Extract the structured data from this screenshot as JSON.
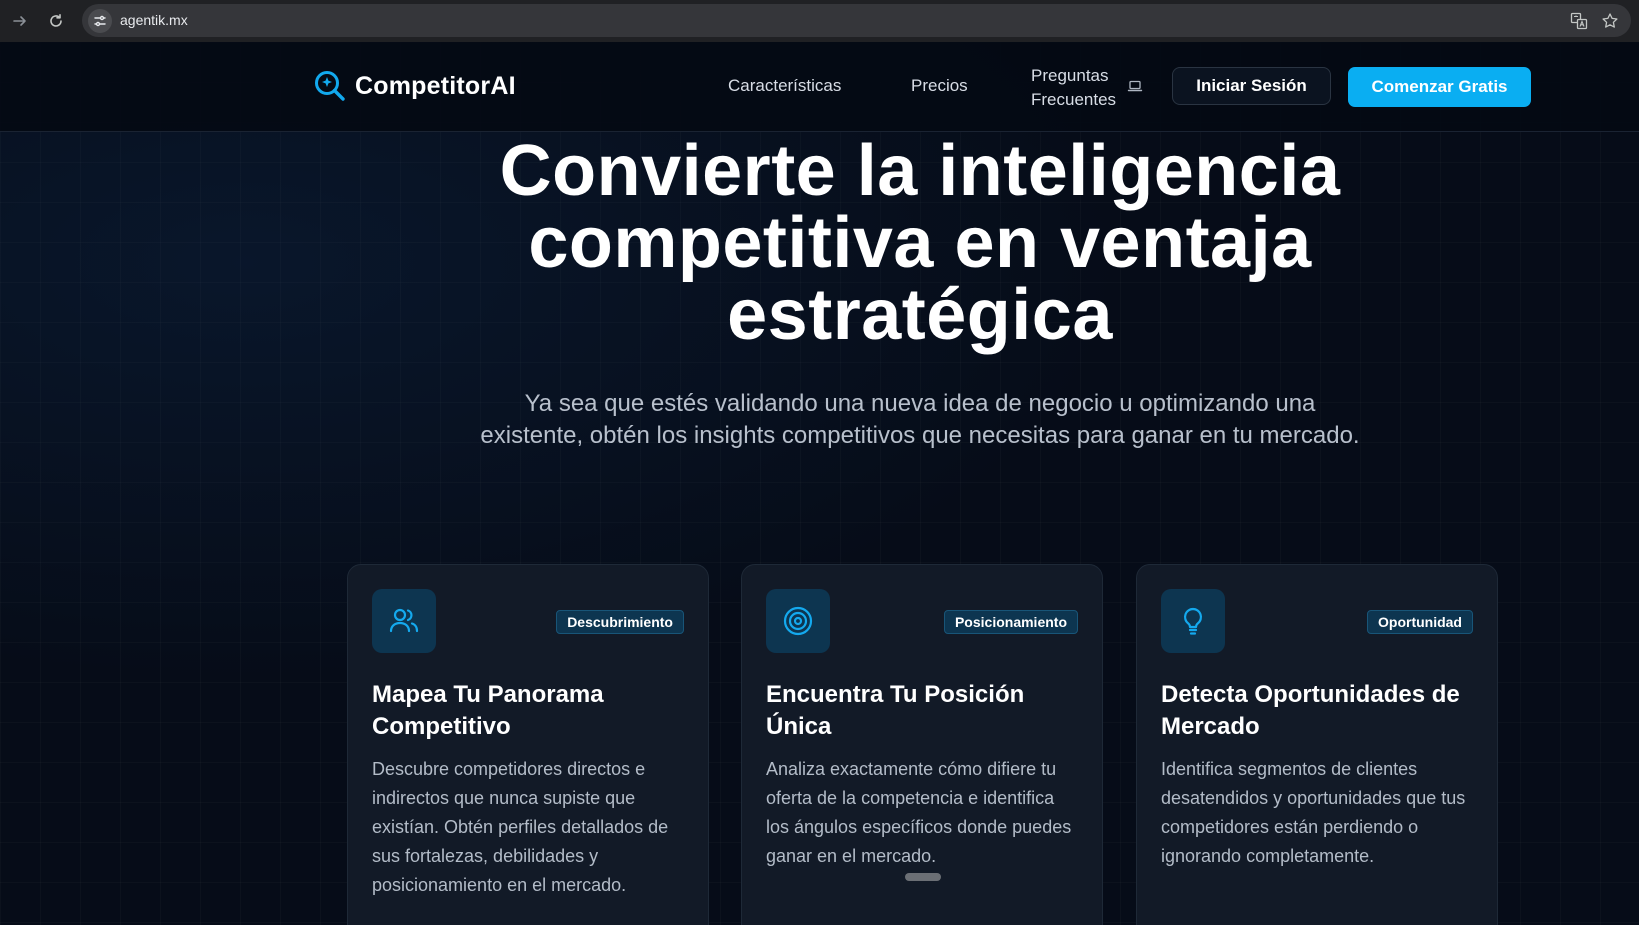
{
  "browser": {
    "url": "agentik.mx",
    "icons": [
      "forward-icon",
      "reload-icon",
      "site-settings-icon",
      "translate-icon",
      "bookmark-star-icon"
    ]
  },
  "header": {
    "logo_text": "CompetitorAI",
    "nav": {
      "features": "Características",
      "pricing": "Precios",
      "faq_line1": "Preguntas",
      "faq_line2": "Frecuentes"
    },
    "login_label": "Iniciar Sesión",
    "start_label": "Comenzar Gratis"
  },
  "hero": {
    "title_line1": "Convierte la inteligencia",
    "title_line2": "competitiva en ventaja",
    "title_line3": "estratégica",
    "subtitle": "Ya sea que estés validando una nueva idea de negocio u optimizando una existente, obtén los insights competitivos que necesitas para ganar en tu mercado."
  },
  "cards": [
    {
      "icon": "users-icon",
      "badge": "Descubrimiento",
      "title": "Mapea Tu Panorama Competitivo",
      "description": "Descubre competidores directos e indirectos que nunca supiste que existían. Obtén perfiles detallados de sus fortalezas, debilidades y posicionamiento en el mercado."
    },
    {
      "icon": "target-icon",
      "badge": "Posicionamiento",
      "title": "Encuentra Tu Posición Única",
      "description": "Analiza exactamente cómo difiere tu oferta de la competencia e identifica los ángulos específicos donde puedes ganar en el mercado."
    },
    {
      "icon": "lightbulb-icon",
      "badge": "Oportunidad",
      "title": "Detecta Oportunidades de Mercado",
      "description": "Identifica segmentos de clientes desatendidos y oportunidades que tus competidores están perdiendo o ignorando completamente."
    }
  ],
  "colors": {
    "accent": "#0aaef2",
    "background": "#060c18",
    "card": "#121a27",
    "icon_box": "#0d3550"
  }
}
